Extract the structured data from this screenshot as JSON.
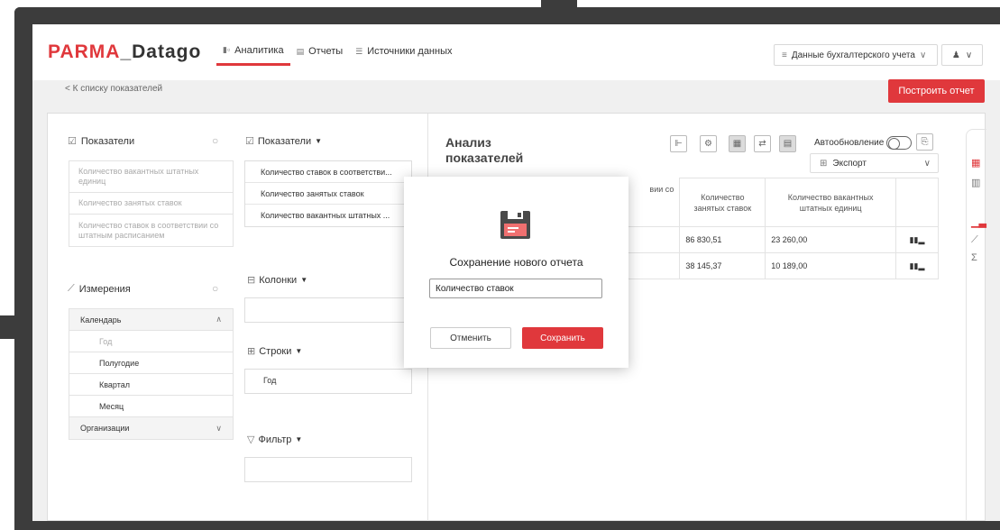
{
  "app": {
    "logo_brand": "PARMA",
    "logo_sep": "_",
    "logo_product": "Datago"
  },
  "nav": [
    {
      "label": "Аналитика",
      "icon": "analytics-icon",
      "active": true
    },
    {
      "label": "Отчеты",
      "icon": "reports-icon",
      "active": false
    },
    {
      "label": "Источники данных",
      "icon": "datasources-icon",
      "active": false
    }
  ],
  "header": {
    "data_source": "Данные бухгалтерского учета",
    "user_icon": "user-icon"
  },
  "back_link": "< К списку показателей",
  "build_report": "Построить отчет",
  "indicators": {
    "title": "Показатели",
    "items": [
      "Количество вакантных штатных единиц",
      "Количество занятых ставок",
      "Количество ставок в соответствии со штатным расписанием"
    ]
  },
  "dimensions": {
    "title": "Измерения",
    "groups": [
      {
        "label": "Календарь",
        "expanded": true,
        "children": [
          "Год",
          "Полугодие",
          "Квартал",
          "Месяц"
        ]
      },
      {
        "label": "Организации",
        "expanded": false,
        "children": []
      }
    ]
  },
  "selected_indicators": {
    "title": "Показатели",
    "items": [
      "Количество ставок в соответстви...",
      "Количество занятых ставок",
      "Количество вакантных штатных ..."
    ]
  },
  "columns": {
    "title": "Колонки",
    "items": []
  },
  "rows": {
    "title": "Строки",
    "items": [
      "Год"
    ]
  },
  "filter": {
    "title": "Фильтр",
    "items": []
  },
  "analysis": {
    "title": "Анализ показателей",
    "auto_update": "Автообновление",
    "auto_update_on": false,
    "export": "Экспорт",
    "table": {
      "headers": [
        "вии со",
        "Количество занятых ставок",
        "Количество вакантных штатных единиц",
        ""
      ],
      "rows": [
        [
          "",
          "86 830,51",
          "23 260,00"
        ],
        [
          "",
          "38 145,37",
          "10 189,00"
        ]
      ]
    }
  },
  "modal": {
    "title": "Сохранение нового отчета",
    "input_value": "Количество ставок",
    "cancel": "Отменить",
    "save": "Сохранить"
  },
  "colors": {
    "accent": "#e0383c",
    "chart_icon": "#1f3e8a"
  }
}
